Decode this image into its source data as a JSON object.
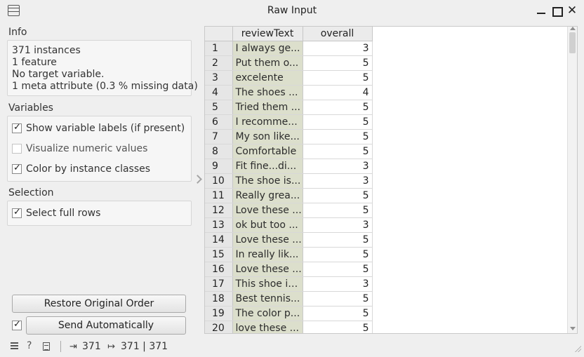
{
  "window": {
    "title": "Raw Input"
  },
  "info": {
    "heading": "Info",
    "lines": [
      "371 instances",
      "1  feature",
      "No target variable.",
      "1 meta attribute (0.3 % missing data)"
    ]
  },
  "variables": {
    "heading": "Variables",
    "show_labels": {
      "label": "Show variable labels (if present)",
      "checked": true
    },
    "visualize_numeric": {
      "label": "Visualize numeric values",
      "checked": false
    },
    "color_by_class": {
      "label": "Color by instance classes",
      "checked": true
    }
  },
  "selection": {
    "heading": "Selection",
    "select_full_rows": {
      "label": "Select full rows",
      "checked": true
    }
  },
  "buttons": {
    "restore": "Restore Original Order",
    "send": "Send Automatically",
    "send_auto_checked": true
  },
  "table": {
    "columns": [
      "reviewText",
      "overall"
    ],
    "rows": [
      [
        "1",
        "I always ge...",
        "3"
      ],
      [
        "2",
        "Put them o...",
        "5"
      ],
      [
        "3",
        "excelente",
        "5"
      ],
      [
        "4",
        "The shoes ...",
        "4"
      ],
      [
        "5",
        "Tried them ...",
        "5"
      ],
      [
        "6",
        "I recomme...",
        "5"
      ],
      [
        "7",
        "My son like...",
        "5"
      ],
      [
        "8",
        "Comfortable",
        "5"
      ],
      [
        "9",
        "Fit fine...di...",
        "3"
      ],
      [
        "10",
        "The shoe is...",
        "3"
      ],
      [
        "11",
        "Really grea...",
        "5"
      ],
      [
        "12",
        "Love these ...",
        "5"
      ],
      [
        "13",
        "ok but too ...",
        "3"
      ],
      [
        "14",
        "Love these ...",
        "5"
      ],
      [
        "15",
        "In really lik...",
        "5"
      ],
      [
        "16",
        "Love these ...",
        "5"
      ],
      [
        "17",
        "This shoe is...",
        "3"
      ],
      [
        "18",
        "Best tennis...",
        "5"
      ],
      [
        "19",
        "The color p...",
        "5"
      ],
      [
        "20",
        "love these ...",
        "5"
      ]
    ]
  },
  "status": {
    "input_count": "371",
    "output_count": "371 | 371"
  },
  "icons": {
    "app": "table-icon",
    "menu": "hamburger-icon",
    "help": "help-icon",
    "report": "document-icon",
    "input": "input-arrow-icon",
    "output": "output-arrow-icon"
  }
}
